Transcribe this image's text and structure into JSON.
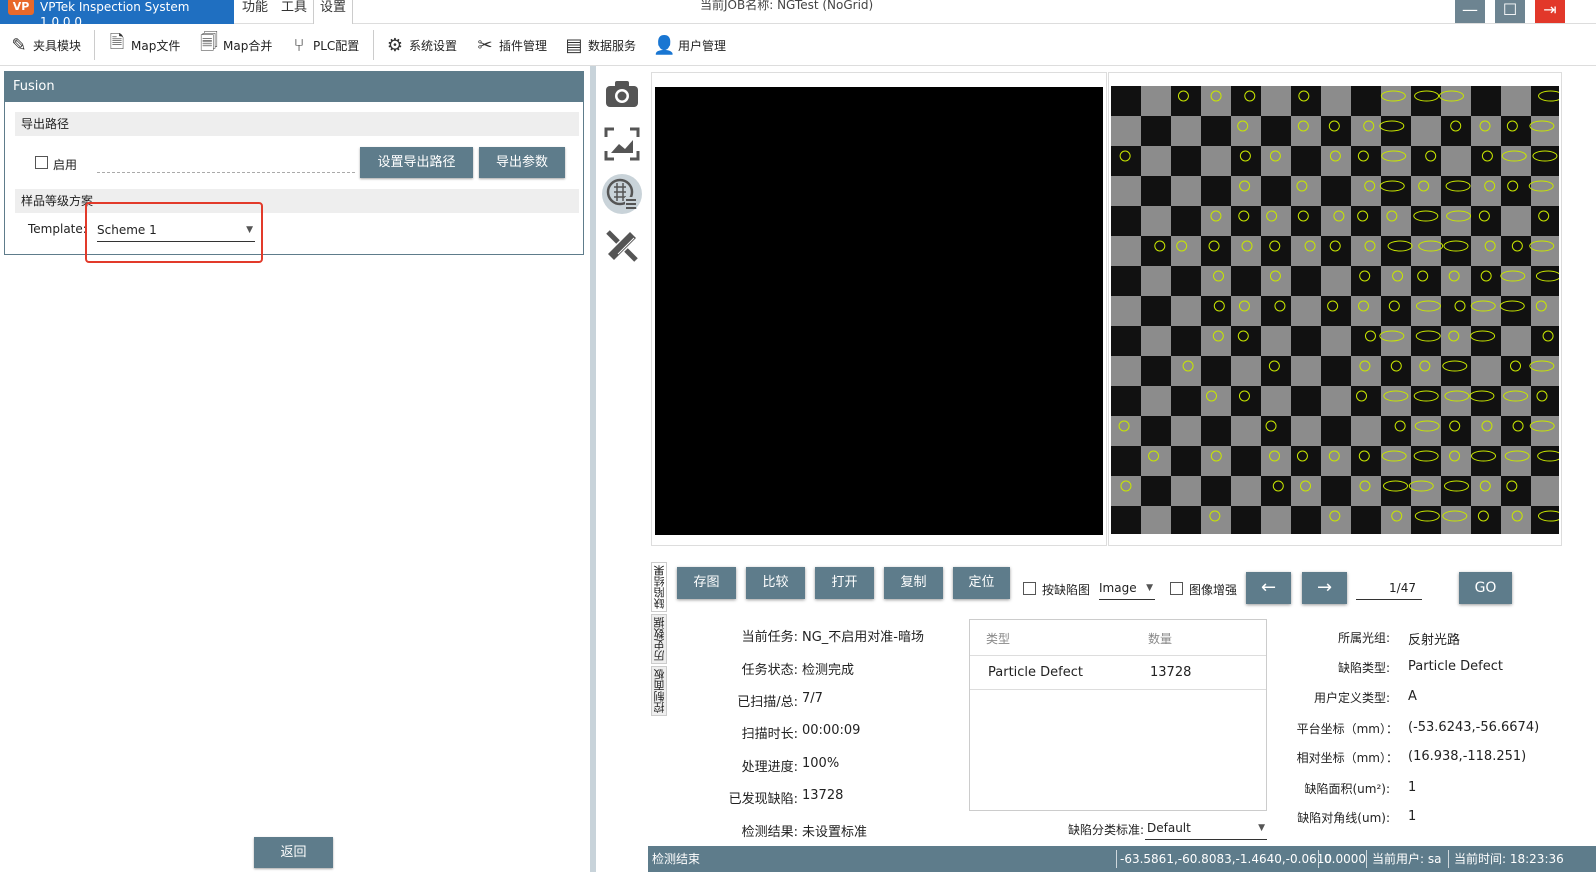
{
  "titlebar": {
    "app_name": "VPTek Inspection System 1.0.0.0",
    "logo_text": "VP",
    "menus": [
      "功能",
      "工具",
      "设置"
    ],
    "job_title": "当前JOB名称:  NGTest (NoGrid)"
  },
  "toolbar": {
    "items": [
      {
        "label": "夹具模块",
        "icon": "wrench-fixture-icon"
      },
      {
        "label": "Map文件",
        "icon": "document-icon"
      },
      {
        "label": "Map合并",
        "icon": "document-merge-icon"
      },
      {
        "label": "PLC配置",
        "icon": "plc-icon"
      },
      {
        "label": "系统设置",
        "icon": "gear-icon"
      },
      {
        "label": "插件管理",
        "icon": "tools-icon"
      },
      {
        "label": "数据服务",
        "icon": "server-icon"
      },
      {
        "label": "用户管理",
        "icon": "user-icon"
      }
    ]
  },
  "left": {
    "fusion_title": "Fusion",
    "export_section": "导出路径",
    "enable_label": "启用",
    "enable_checked": false,
    "set_path_button": "设置导出路径",
    "export_params_button": "导出参数",
    "grade_section": "样品等级方案",
    "template_label": "Template:",
    "template_value": "Scheme 1",
    "back_button": "返回"
  },
  "tabs": {
    "defect_result": "缺陷结果",
    "history_data": "历史数据",
    "control_panel": "控制面板"
  },
  "actions": {
    "save_image": "存图",
    "compare": "比较",
    "open": "打开",
    "copy": "复制",
    "locate": "定位",
    "by_defect_label": "按缺陷图",
    "image_select": "Image",
    "enhance_label": "图像增强",
    "prev": "←",
    "next": "→",
    "page": "1/47",
    "go": "GO"
  },
  "task_info": {
    "current_task_label": "当前任务:",
    "current_task_value": "NG_不启用对准-暗场",
    "task_status_label": "任务状态:",
    "task_status_value": "检测完成",
    "scanned_label": "已扫描/总:",
    "scanned_value": "7/7",
    "scan_time_label": "扫描时长:",
    "scan_time_value": "00:00:09",
    "progress_label": "处理进度:",
    "progress_value": "100%",
    "defects_found_label": "已发现缺陷:",
    "defects_found_value": "13728",
    "result_label": "检测结果:",
    "result_value": "未设置标准"
  },
  "defect_table": {
    "headers": [
      "类型",
      "数量"
    ],
    "rows": [
      {
        "type": "Particle Defect",
        "count": "13728"
      }
    ],
    "classify_label": "缺陷分类标准:",
    "classify_value": "Default"
  },
  "defect_info": {
    "optics_group_label": "所属光组:",
    "optics_group_value": "反射光路",
    "defect_type_label": "缺陷类型:",
    "defect_type_value": "Particle Defect",
    "user_type_label": "用户定义类型:",
    "user_type_value": "A",
    "platform_coord_label": "平台坐标（mm）：",
    "platform_coord_value": "(-53.6243,-56.6674)",
    "relative_coord_label": "相对坐标（mm）：",
    "relative_coord_value": "(16.938,-118.251)",
    "area_label": "缺陷面积(um²):",
    "area_value": "1",
    "diagonal_label": "缺陷对角线(um):",
    "diagonal_value": "1"
  },
  "status": {
    "left_text": "检测结束",
    "coords": "-63.5861,-60.8083,-1.4640,-0.0610",
    "value": "0.0000",
    "user": "当前用户: sa",
    "time": "当前时间: 18:23:36"
  },
  "colors": {
    "accent": "#5e7c8b",
    "title_blue": "#1f6fc1",
    "close_red": "#e2382a",
    "highlight_red": "#e23a2a",
    "defect_marker": "#c8e600"
  }
}
